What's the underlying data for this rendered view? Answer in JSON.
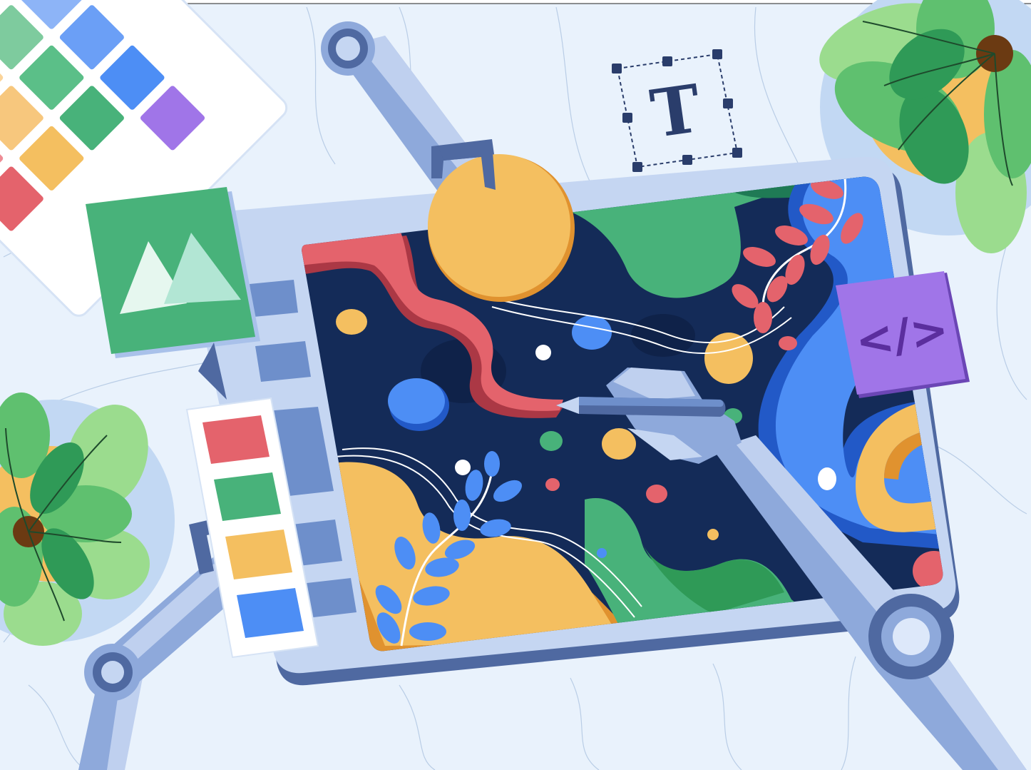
{
  "scene": {
    "text_tool_glyph": "T",
    "code_badge_glyph": "</>"
  },
  "colors": {
    "background": "#e9f2fc",
    "tablet_frame": "#c5d6f2",
    "tablet_shadow": "#4f69a1",
    "canvas_navy": "#142b58",
    "red": "#e4636c",
    "green": "#48b27a",
    "yellow": "#f4bf60",
    "blue": "#4d8ef5",
    "purple": "#a075e8",
    "robot_steel": "#8ea9db",
    "robot_light": "#bfd0ef",
    "robot_dark": "#4f69a1"
  },
  "swatches": [
    "red",
    "green",
    "yellow",
    "blue"
  ],
  "icons": [
    "image-icon",
    "text-tool-icon",
    "code-icon",
    "color-palette",
    "pen-stylus",
    "plant"
  ]
}
